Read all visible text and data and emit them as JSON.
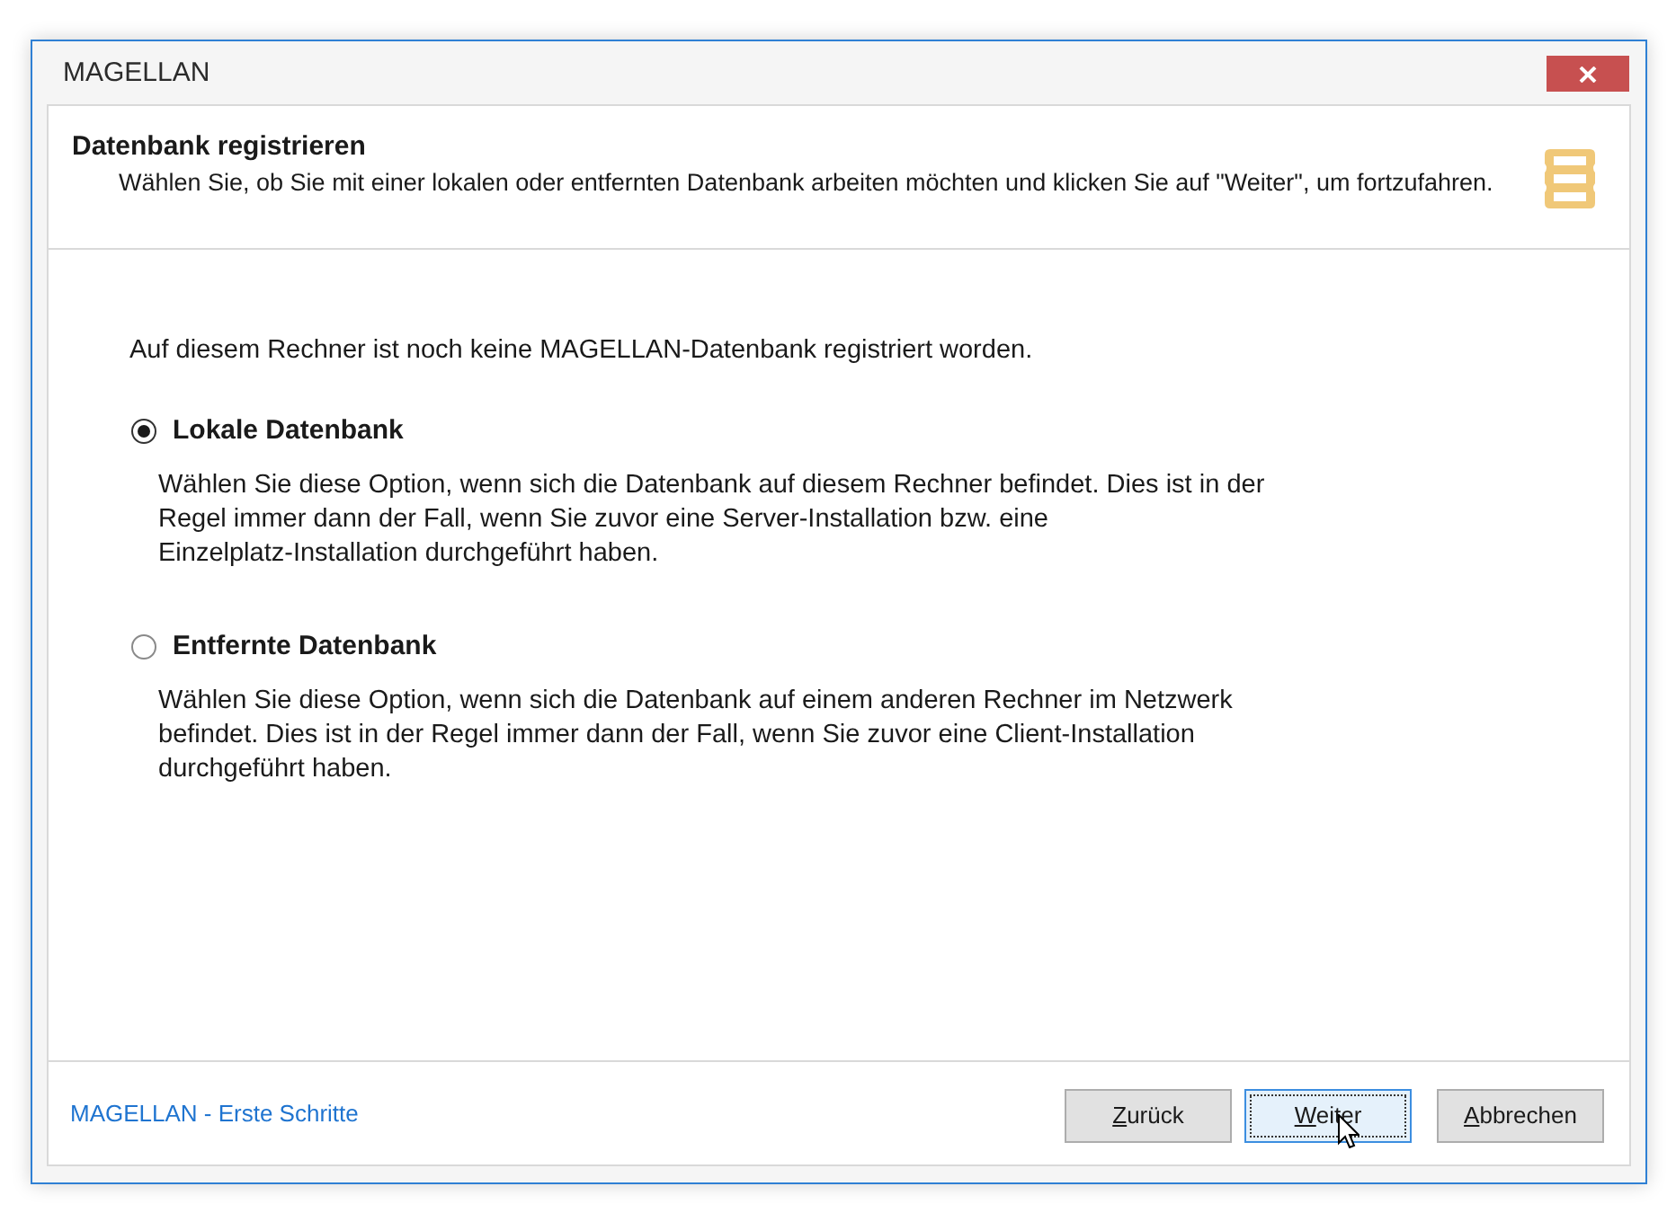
{
  "window": {
    "title": "MAGELLAN"
  },
  "header": {
    "title": "Datenbank registrieren",
    "subtitle": "Wählen Sie, ob Sie mit einer lokalen oder entfernten Datenbank arbeiten möchten und klicken Sie auf \"Weiter\", um fortzufahren."
  },
  "intro": "Auf diesem Rechner ist noch keine MAGELLAN-Datenbank registriert worden.",
  "options": [
    {
      "label": "Lokale Datenbank",
      "selected": true,
      "description": "Wählen Sie diese Option, wenn sich die Datenbank auf diesem Rechner befindet. Dies ist in der Regel immer dann der Fall, wenn Sie zuvor eine Server-Installation bzw. eine Einzelplatz-Installation durchgeführt haben."
    },
    {
      "label": "Entfernte Datenbank",
      "selected": false,
      "description": "Wählen Sie diese Option, wenn sich die Datenbank auf einem anderen Rechner im Netzwerk befindet. Dies ist in der Regel immer dann der Fall, wenn Sie zuvor eine Client-Installation durchgeführt haben."
    }
  ],
  "footer": {
    "link": "MAGELLAN - Erste Schritte",
    "buttons": [
      {
        "label": "Zurück",
        "mnemonic": true,
        "focused": false
      },
      {
        "label": "Weiter",
        "mnemonic": true,
        "focused": true
      },
      {
        "label": "Abbrechen",
        "mnemonic": true,
        "focused": false
      }
    ]
  }
}
